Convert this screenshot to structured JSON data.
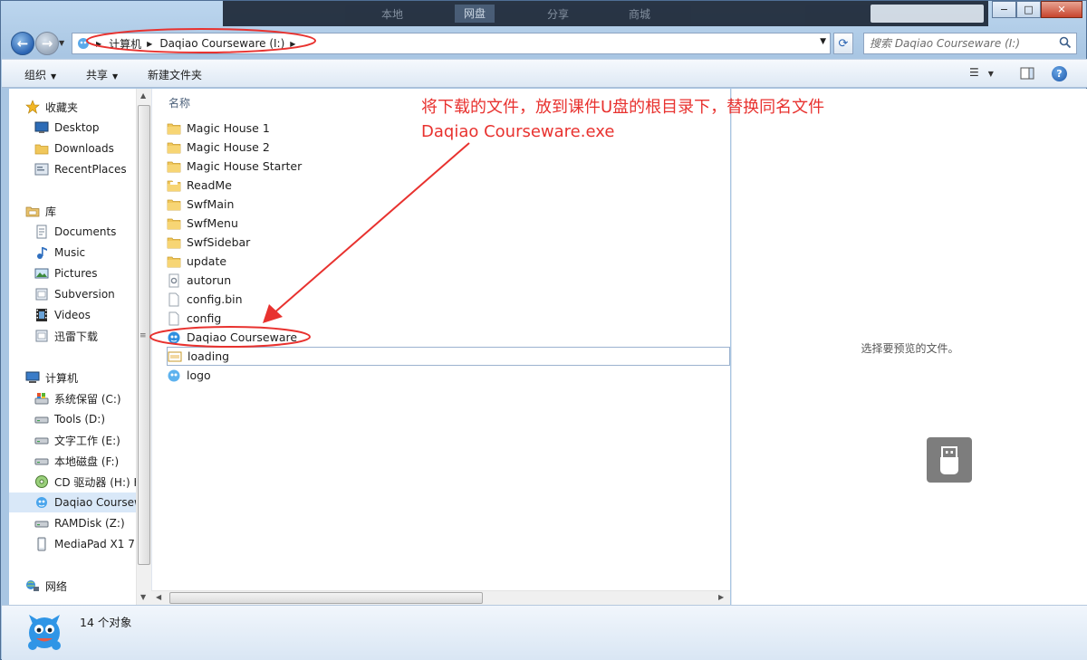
{
  "window": {
    "background_tabs": [
      "本地",
      "网盘",
      "分享",
      "商城"
    ],
    "controls": {
      "minimize": "−",
      "maximize": "□",
      "close": "✕"
    }
  },
  "address_bar": {
    "crumbs": [
      "计算机",
      "Daqiao Courseware (I:)"
    ],
    "search_placeholder": "搜索 Daqiao Courseware (I:)"
  },
  "toolbar": {
    "organize": "组织",
    "share": "共享",
    "new_folder": "新建文件夹",
    "help": "?"
  },
  "nav": {
    "favorites": {
      "header": "收藏夹",
      "items": [
        "Desktop",
        "Downloads",
        "RecentPlaces"
      ]
    },
    "libraries": {
      "header": "库",
      "items": [
        "Documents",
        "Music",
        "Pictures",
        "Subversion",
        "Videos",
        "迅雷下载"
      ]
    },
    "computer": {
      "header": "计算机",
      "items": [
        "系统保留 (C:)",
        "Tools (D:)",
        "文字工作 (E:)",
        "本地磁盘 (F:)",
        "CD 驱动器 (H:) H",
        "Daqiao Courseware (I:)",
        "RAMDisk (Z:)",
        "MediaPad X1 7"
      ]
    },
    "network": {
      "header": "网络"
    }
  },
  "files": {
    "column_name": "名称",
    "items": [
      {
        "name": "Magic House 1",
        "type": "folder"
      },
      {
        "name": "Magic House 2",
        "type": "folder"
      },
      {
        "name": "Magic House Starter",
        "type": "folder"
      },
      {
        "name": "ReadMe",
        "type": "folder"
      },
      {
        "name": "SwfMain",
        "type": "folder"
      },
      {
        "name": "SwfMenu",
        "type": "folder"
      },
      {
        "name": "SwfSidebar",
        "type": "folder"
      },
      {
        "name": "update",
        "type": "folder"
      },
      {
        "name": "autorun",
        "type": "settings"
      },
      {
        "name": "config.bin",
        "type": "file"
      },
      {
        "name": "config",
        "type": "file"
      },
      {
        "name": "Daqiao Courseware",
        "type": "app"
      },
      {
        "name": "loading",
        "type": "image"
      },
      {
        "name": "logo",
        "type": "app"
      }
    ]
  },
  "preview": {
    "message": "选择要预览的文件。"
  },
  "status": {
    "count": "14 个对象"
  },
  "annotation": {
    "line1": "将下载的文件，放到课件U盘的根目录下，替换同名文件",
    "line2": "Daqiao Courseware.exe",
    "color": "#e8322f"
  }
}
